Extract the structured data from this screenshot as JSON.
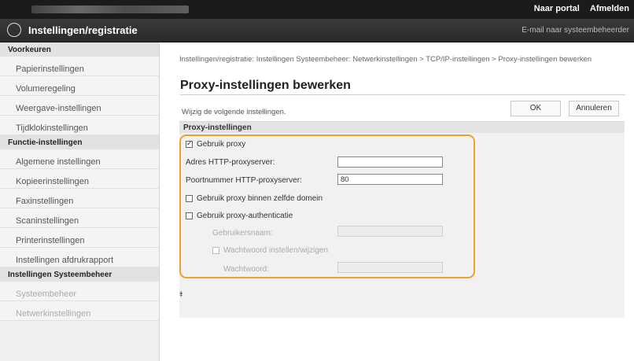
{
  "topbar": {
    "links": [
      "Naar portal",
      "Afmelden"
    ]
  },
  "appbar": {
    "title": "Instellingen/registratie",
    "email_link": "E-mail naar systeembeheerder"
  },
  "sidebar": {
    "sections": [
      {
        "header": "Voorkeuren",
        "items": [
          "Papierinstellingen",
          "Volumeregeling",
          "Weergave-instellingen",
          "Tijdklokinstellingen"
        ]
      },
      {
        "header": "Functie-instellingen",
        "items": [
          "Algemene instellingen",
          "Kopieerinstellingen",
          "Faxinstellingen",
          "Scaninstellingen",
          "Printerinstellingen",
          "Instellingen afdrukrapport"
        ]
      },
      {
        "header": "Instellingen Systeembeheer",
        "items": [
          "Systeembeheer",
          "Netwerkinstellingen"
        ]
      }
    ]
  },
  "main": {
    "breadcrumb": "Instellingen/registratie: Instellingen Systeembeheer: Netwerkinstellingen > TCP/IP-instellingen > Proxy-instellingen bewerken",
    "title": "Proxy-instellingen bewerken",
    "instruction": "Wijzig de volgende instellingen.",
    "ok_label": "OK",
    "cancel_label": "Annuleren",
    "section_header": "Proxy-instellingen",
    "use_proxy_label": "Gebruik proxy",
    "use_proxy_checked": true,
    "http_address_label": "Adres HTTP-proxyserver:",
    "http_address_value": "",
    "http_port_label": "Poortnummer HTTP-proxyserver:",
    "http_port_value": "80",
    "same_domain_label": "Gebruik proxy binnen zelfde domein",
    "same_domain_checked": false,
    "auth_label": "Gebruik proxy-authenticatie",
    "auth_checked": false,
    "username_label": "Gebruikersnaam:",
    "username_value": "",
    "set_password_label": "Wachtwoord instellen/wijzigen",
    "password_label": "Wachtwoord:",
    "password_value": "",
    "to_top": "⯒"
  },
  "colors": {
    "topbar": "#1b1b1b",
    "highlight": "#f0a030"
  }
}
